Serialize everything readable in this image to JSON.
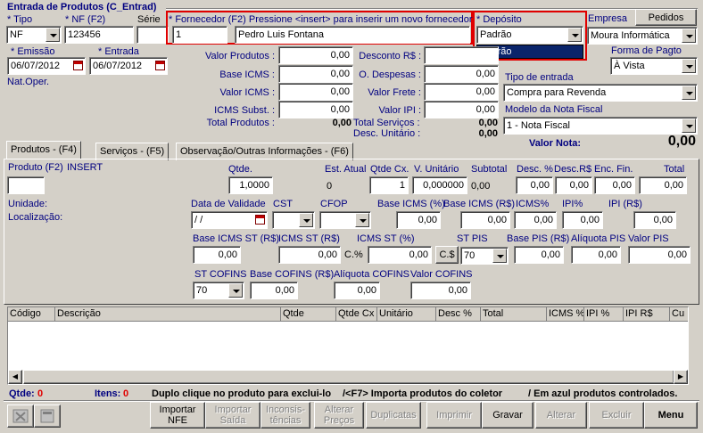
{
  "window": {
    "title": "Entrada de Produtos (C_Entrad)"
  },
  "header": {
    "tipo_label": "* Tipo",
    "tipo_value": "NF",
    "nf_label": "* NF (F2)",
    "nf_value": "123456",
    "serie_label": "Série",
    "serie_value": "",
    "fornecedor_label": "* Fornecedor (F2) Pressione <insert> para inserir um novo fornecedor",
    "fornecedor_code": "1",
    "fornecedor_name": "Pedro Luis Fontana",
    "deposito_label": "* Depósito",
    "deposito_value": "Padrão",
    "deposito_option": "Padrão",
    "empresa_label": "Empresa",
    "empresa_value": "Moura Informática",
    "pedidos_button": "Pedidos",
    "emissao_label": "* Emissão",
    "emissao_value": "06/07/2012",
    "entrada_label": "* Entrada",
    "entrada_value": "06/07/2012",
    "natoper_label": "Nat.Oper.",
    "forma_pagto_label": "Forma de Pagto",
    "forma_pagto_value": "À Vista",
    "tipo_entrada_label": "Tipo de entrada",
    "tipo_entrada_value": "Compra para Revenda",
    "modelo_nf_label": "Modelo da Nota Fiscal",
    "modelo_nf_value": "1 - Nota Fiscal",
    "valor_nota_label": "Valor Nota:",
    "valor_nota_value": "0,00"
  },
  "totals": {
    "valor_produtos_label": "Valor Produtos :",
    "valor_produtos": "0,00",
    "base_icms_label": "Base ICMS :",
    "base_icms": "0,00",
    "valor_icms_label": "Valor ICMS :",
    "valor_icms": "0,00",
    "icms_subst_label": "ICMS Subst. :",
    "icms_subst": "0,00",
    "total_produtos_label": "Total Produtos :",
    "total_produtos": "0,00",
    "desconto_label": "Desconto R$ :",
    "desconto": "",
    "o_despesas_label": "O. Despesas :",
    "o_despesas": "0,00",
    "valor_frete_label": "Valor Frete :",
    "valor_frete": "0,00",
    "valor_ipi_label": "Valor IPI :",
    "valor_ipi": "0,00",
    "total_servicos_label": "Total Serviços :",
    "total_servicos": "0,00",
    "desc_unitario_label": "Desc. Unitário :",
    "desc_unitario": "0,00"
  },
  "tabs": [
    {
      "label": "Produtos  - (F4)"
    },
    {
      "label": "Serviços  - (F5)"
    },
    {
      "label": "Observação/Outras Informações - (F6)"
    }
  ],
  "product": {
    "produto_label": "Produto (F2)",
    "insert_label": "INSERT",
    "unidade_label": "Unidade:",
    "localizacao_label": "Localização:",
    "qtde_label": "Qtde.",
    "qtde_value": "1,0000",
    "est_atual_label": "Est. Atual",
    "est_atual_value": "0",
    "qtde_cx_label": "Qtde Cx.",
    "qtde_cx_value": "1",
    "v_unitario_label": "V. Unitário",
    "v_unitario_value": "0,000000",
    "subtotal_label": "Subtotal",
    "subtotal_value": "0,00",
    "desc_pct_label": "Desc. %",
    "desc_pct_value": "0,00",
    "desc_rs_label": "Desc.R$",
    "desc_rs_value": "0,00",
    "enc_fin_label": "Enc. Fin.",
    "enc_fin_value": "0,00",
    "total_label": "Total",
    "total_value": "0,00",
    "data_validade_label": "Data de Validade",
    "data_validade_value": " / /",
    "cst_label": "CST",
    "cfop_label": "CFOP",
    "base_icms_pct_label": "Base ICMS (%)",
    "base_icms_pct_value": "0,00",
    "base_icms_rs_label": "Base ICMS (R$)",
    "base_icms_rs_value": "0,00",
    "icms_pct_label": "ICMS%",
    "icms_pct_value": "0,00",
    "ipi_pct_label": "IPI%",
    "ipi_pct_value": "0,00",
    "ipi_rs_label": "IPI (R$)",
    "ipi_rs_value": "0,00",
    "base_icms_st_rs_label": "Base ICMS ST (R$)",
    "base_icms_st_rs_value": "0,00",
    "icms_st_rs_label": "ICMS ST (R$)",
    "icms_st_rs_value": "0,00",
    "c_pct_label": "C.%",
    "icms_st_pct_label": "ICMS ST (%)",
    "icms_st_pct_value": "0,00",
    "cs_label": "C.$",
    "st_pis_label": "ST PIS",
    "st_pis_value": "70",
    "base_pis_label": "Base PIS (R$)",
    "base_pis_value": "0,00",
    "aliquota_pis_label": "Alíquota PIS",
    "aliquota_pis_value": "0,00",
    "valor_pis_label": "Valor PIS",
    "valor_pis_value": "0,00",
    "st_cofins_label": "ST COFINS",
    "st_cofins_value": "70",
    "base_cofins_label": "Base COFINS (R$)",
    "base_cofins_value": "0,00",
    "aliquota_cofins_label": "Alíquota COFINS",
    "aliquota_cofins_value": "0,00",
    "valor_cofins_label": "Valor COFINS",
    "valor_cofins_value": "0,00"
  },
  "grid": {
    "columns": [
      "Código",
      "Descrição",
      "Qtde",
      "Qtde Cx",
      "Unitário",
      "Desc %",
      "Total",
      "ICMS %",
      "IPI %",
      "IPI R$",
      "Cu"
    ]
  },
  "status": {
    "qtde_label": "Qtde:",
    "qtde_value": "0",
    "itens_label": "Itens:",
    "itens_value": "0",
    "hint1": "Duplo clique no produto para exclui-lo",
    "hint2": "/<F7> Importa produtos do coletor",
    "hint3": "/ Em azul produtos controlados."
  },
  "toolbar": {
    "importar_nfe": "Importar NFE",
    "importar_saida": "Importar Saída",
    "inconsistencias": "Inconsis- tências",
    "alterar_precos": "Alterar Preços",
    "duplicatas": "Duplicatas",
    "imprimir": "Imprimir",
    "gravar": "Gravar",
    "alterar": "Alterar",
    "excluir": "Excluir",
    "menu": "Menu"
  }
}
